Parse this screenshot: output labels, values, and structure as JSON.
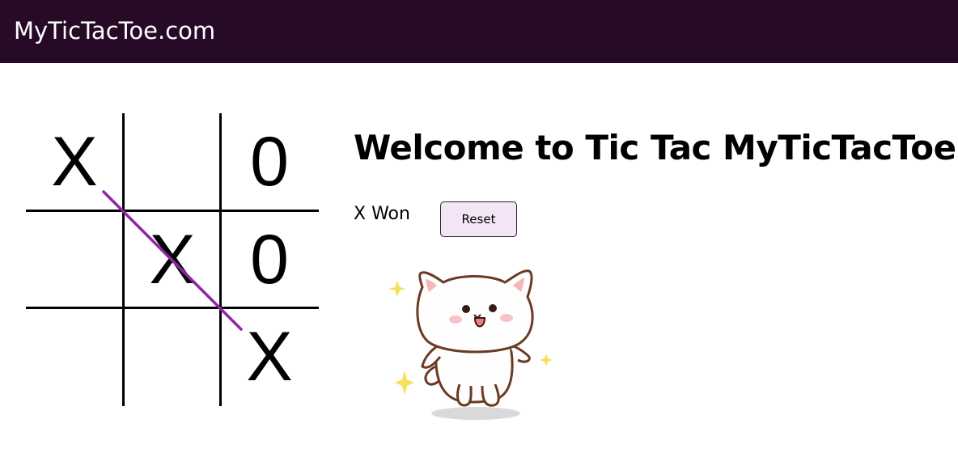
{
  "header": {
    "brand": "MyTicTacToe.com"
  },
  "game": {
    "board": [
      "X",
      "",
      "0",
      "",
      "X",
      "0",
      "",
      "",
      "X"
    ],
    "winning_line": [
      0,
      4,
      8
    ],
    "status": "X Won",
    "reset_label": "Reset"
  },
  "main": {
    "title": "Welcome to Tic Tac MyTicTacToe"
  },
  "colors": {
    "header_bg": "#260a26",
    "win_line": "#8e24aa",
    "reset_bg": "#f3e5f5"
  },
  "illustration": {
    "icon": "celebrating-cat-sticker"
  }
}
